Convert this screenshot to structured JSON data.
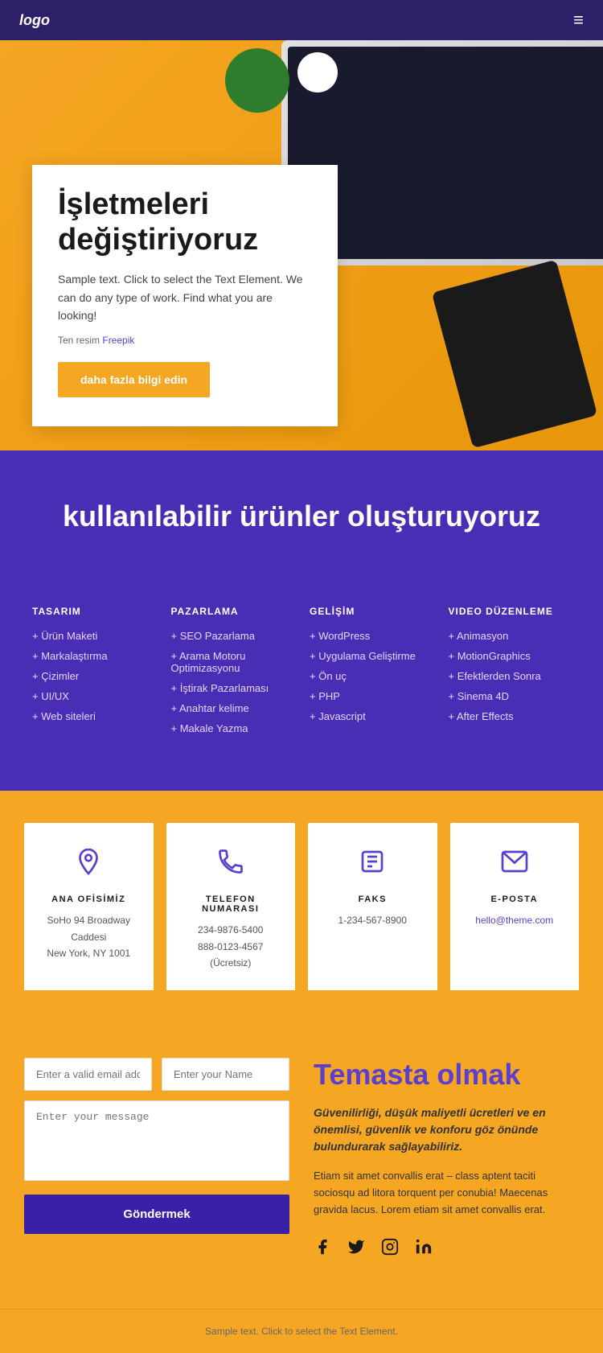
{
  "header": {
    "logo": "logo",
    "menu_icon": "≡"
  },
  "hero": {
    "title_line1": "İşletmeleri",
    "title_line2": "değiştiriyoruz",
    "description": "Sample text. Click to select the Text Element. We can do any type of work. Find what you are looking!",
    "credit_text": "Ten resim ",
    "credit_link": "Freepik",
    "button_label": "daha fazla bilgi edin"
  },
  "purple": {
    "title": "kullanılabilir ürünler oluşturuyoruz"
  },
  "services": {
    "columns": [
      {
        "heading": "TASARIM",
        "items": [
          "Ürün Maketi",
          "Markalaştırma",
          "Çizimler",
          "UI/UX",
          "Web siteleri"
        ]
      },
      {
        "heading": "PAZARLAMA",
        "items": [
          "SEO Pazarlama",
          "Arama Motoru Optimizasyonu",
          "İştirak Pazarlaması",
          "Anahtar kelime",
          "Makale Yazma"
        ]
      },
      {
        "heading": "GELİŞİM",
        "items": [
          "WordPress",
          "Uygulama Geliştirme",
          "Ön uç",
          "PHP",
          "Javascript"
        ]
      },
      {
        "heading": "VIDEO DÜZENLEME",
        "items": [
          "Animasyon",
          "MotionGraphics",
          "Efektlerden Sonra",
          "Sinema 4D",
          "After Effects"
        ]
      }
    ]
  },
  "contact_cards": [
    {
      "icon": "📍",
      "title": "ANA OFİSİMİZ",
      "lines": [
        "SoHo 94 Broadway Caddesi",
        "New York, NY 1001"
      ]
    },
    {
      "icon": "📞",
      "title": "TELEFON NUMARASI",
      "lines": [
        "234-9876-5400",
        "888-0123-4567 (Ücretsiz)"
      ]
    },
    {
      "icon": "📠",
      "title": "FAKS",
      "lines": [
        "1-234-567-8900"
      ]
    },
    {
      "icon": "✉",
      "title": "E-POSTA",
      "lines": [
        "hello@theme.com"
      ],
      "is_link": true
    }
  ],
  "form": {
    "email_placeholder": "Enter a valid email address",
    "name_placeholder": "Enter your Name",
    "message_placeholder": "Enter your message",
    "submit_label": "Göndermek",
    "contact_title": "Temasta olmak",
    "tagline": "Güvenilirliği, düşük maliyetli ücretleri ve en önemlisi, güvenlik ve konforu göz önünde bulundurarak sağlayabiliriz.",
    "description": "Etiam sit amet convallis erat – class aptent taciti sociosqu ad litora torquent per conubia! Maecenas gravida lacus. Lorem etiam sit amet convallis erat.",
    "social": {
      "facebook": "f",
      "twitter": "𝕏",
      "instagram": "⊙",
      "linkedin": "in"
    }
  },
  "footer": {
    "text": "Sample text. Click to select the Text Element."
  }
}
